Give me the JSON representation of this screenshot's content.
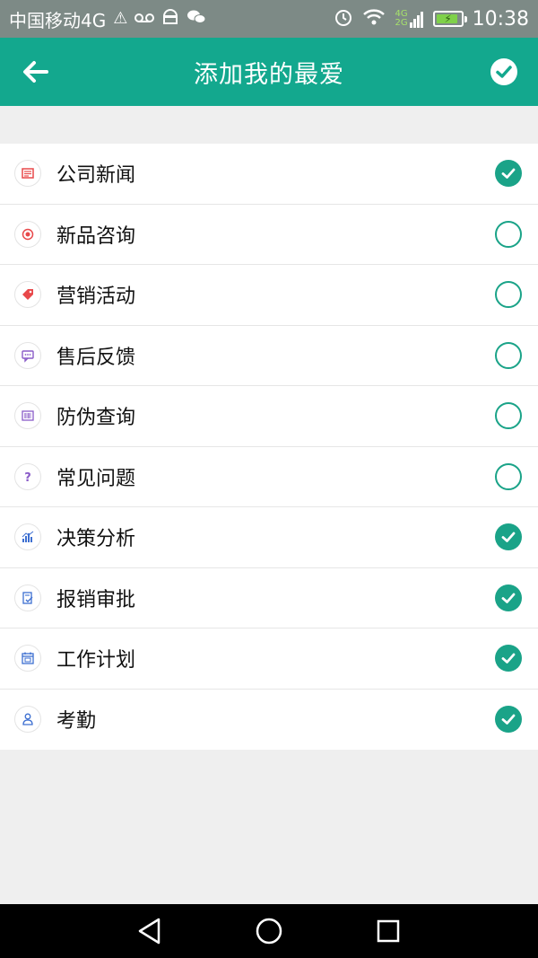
{
  "status_bar": {
    "carrier": "中国移动4G",
    "net_top": "4G",
    "net_bottom": "2G",
    "time": "10:38",
    "battery_level": 0.9
  },
  "header": {
    "title": "添加我的最爱",
    "back_icon": "arrow-left-icon",
    "confirm_icon": "check-circle-icon"
  },
  "favorites": [
    {
      "label": "公司新闻",
      "icon": "newspaper-icon",
      "icon_color": "#e8484a",
      "checked": true
    },
    {
      "label": "新品咨询",
      "icon": "new-product-icon",
      "icon_color": "#e8484a",
      "checked": false
    },
    {
      "label": "营销活动",
      "icon": "tag-icon",
      "icon_color": "#e8484a",
      "checked": false
    },
    {
      "label": "售后反馈",
      "icon": "message-icon",
      "icon_color": "#8a5cc8",
      "checked": false
    },
    {
      "label": "防伪查询",
      "icon": "barcode-icon",
      "icon_color": "#8a5cc8",
      "checked": false
    },
    {
      "label": "常见问题",
      "icon": "question-icon",
      "icon_color": "#8a5cc8",
      "checked": false
    },
    {
      "label": "决策分析",
      "icon": "bar-chart-icon",
      "icon_color": "#3d6fd1",
      "checked": true
    },
    {
      "label": "报销审批",
      "icon": "approval-icon",
      "icon_color": "#3d6fd1",
      "checked": true
    },
    {
      "label": "工作计划",
      "icon": "calendar-icon",
      "icon_color": "#3d6fd1",
      "checked": true
    },
    {
      "label": "考勤",
      "icon": "person-icon",
      "icon_color": "#3d6fd1",
      "checked": true
    }
  ],
  "colors": {
    "accent": "#13a88e",
    "check": "#1aa388"
  }
}
